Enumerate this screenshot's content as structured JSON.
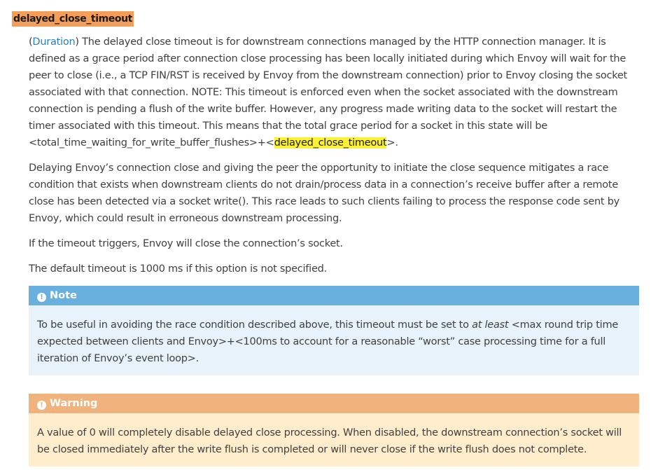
{
  "term": "delayed_close_timeout",
  "description": {
    "type_link": "Duration",
    "p1_open": "(",
    "p1_close": ")",
    "p1_text": " The delayed close timeout is for downstream connections managed by the HTTP connection manager. It is defined as a grace period after connection close processing has been locally initiated during which Envoy will wait for the peer to close (i.e., a TCP FIN/RST is received by Envoy from the downstream connection) prior to Envoy closing the socket associated with that connection. NOTE: This timeout is enforced even when the socket associated with the downstream connection is pending a flush of the write buffer. However, any progress made writing data to the socket will restart the timer associated with this timeout. This means that the total grace period for a socket in this state will be <total_time_waiting_for_write_buffer_flushes>+<",
    "p1_highlight": "delayed_close_timeout",
    "p1_end": ">.",
    "p2": "Delaying Envoy’s connection close and giving the peer the opportunity to initiate the close sequence mitigates a race condition that exists when downstream clients do not drain/process data in a connection’s receive buffer after a remote close has been detected via a socket write(). This race leads to such clients failing to process the response code sent by Envoy, which could result in erroneous downstream processing.",
    "p3": "If the timeout triggers, Envoy will close the connection’s socket.",
    "p4": "The default timeout is 1000 ms if this option is not specified."
  },
  "note": {
    "title": "Note",
    "icon": "exclamation-circle-icon",
    "text_before": "To be useful in avoiding the race condition described above, this timeout must be set to ",
    "text_em": "at least",
    "text_after": " <max round trip time expected between clients and Envoy>+<100ms to account for a reasonable “worst” case processing time for a full iteration of Envoy’s event loop>."
  },
  "warning": {
    "title": "Warning",
    "icon": "exclamation-circle-icon",
    "text": "A value of 0 will completely disable delayed close processing. When disabled, the downstream connection’s socket will be closed immediately after the write flush is completed or will never close if the write flush does not complete."
  },
  "colors": {
    "term_highlight": "#f49e5a",
    "search_highlight": "#fbf236",
    "link": "#2980b9",
    "note_header": "#6ab0de",
    "note_body": "#e7f2fa",
    "warning_header": "#f0b37e",
    "warning_body": "#ffedcc"
  }
}
